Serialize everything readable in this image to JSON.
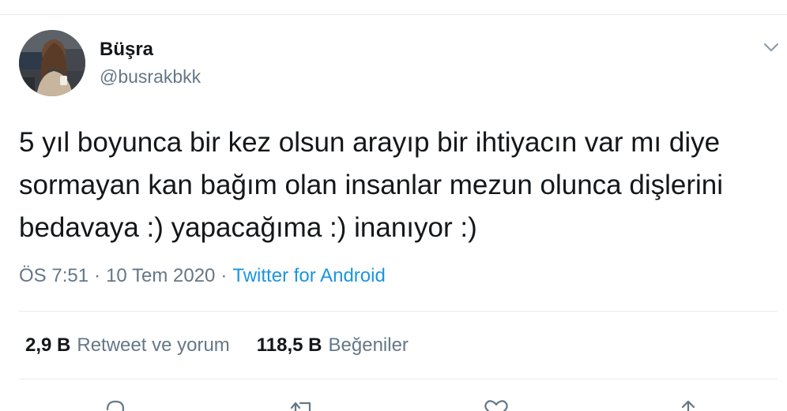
{
  "colors": {
    "text_primary": "#14171a",
    "text_secondary": "#657786",
    "link": "#1b95e0",
    "divider": "#e6ecf0"
  },
  "author": {
    "display_name": "Büşra",
    "handle": "@busrakbkk",
    "avatar_icon": "profile-photo"
  },
  "tweet": {
    "lines": [
      "5 yıl boyunca bir kez olsun arayıp bir ihtiyacın var mı diye",
      "sormayan kan bağım olan insanlar mezun olunca dişlerini",
      "bedavaya :) yapacağıma :) inanıyor :)"
    ],
    "time": "ÖS 7:51",
    "separator": "·",
    "date": "10 Tem 2020",
    "source": "Twitter for Android"
  },
  "stats": {
    "retweets_count": "2,9 B",
    "retweets_label": "Retweet ve yorum",
    "likes_count": "118,5 B",
    "likes_label": "Beğeniler"
  },
  "actions": {
    "icons": [
      "reply-icon",
      "retweet-icon",
      "like-icon",
      "share-icon"
    ]
  }
}
